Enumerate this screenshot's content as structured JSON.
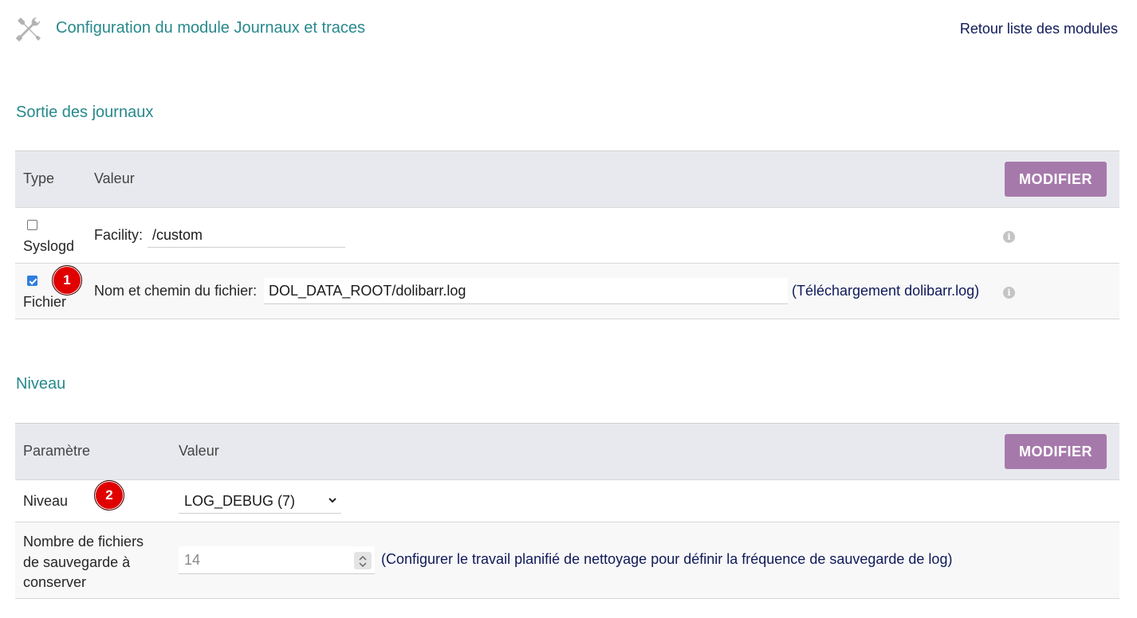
{
  "header": {
    "title": "Configuration du module Journaux et traces",
    "back_link": "Retour liste des modules",
    "icon": "tools-icon"
  },
  "log_output": {
    "section_title": "Sortie des journaux",
    "columns": {
      "type": "Type",
      "value": "Valeur"
    },
    "modify_label": "MODIFIER",
    "rows": [
      {
        "type": "Syslogd",
        "checked": false,
        "field_label": "Facility:",
        "field_value": "/custom"
      },
      {
        "type": "Fichier",
        "checked": true,
        "badge": "1",
        "field_label": "Nom et chemin du fichier:",
        "field_value": "DOL_DATA_ROOT/dolibarr.log",
        "link": "(Téléchargement dolibarr.log)"
      }
    ]
  },
  "level": {
    "section_title": "Niveau",
    "columns": {
      "param": "Paramètre",
      "value": "Valeur"
    },
    "modify_label": "MODIFIER",
    "rows": [
      {
        "label": "Niveau",
        "badge": "2",
        "selected": "LOG_DEBUG (7)"
      },
      {
        "label_lines": [
          "Nombre de fichiers",
          "de sauvegarde à",
          "conserver"
        ],
        "value": "14",
        "link": "(Configurer le travail planifié de nettoyage pour définir la fréquence de sauvegarde de log)"
      }
    ]
  },
  "colors": {
    "accent_title": "#27898c",
    "button": "#a679ab",
    "link": "#0f1a59",
    "badge": "#e00000"
  }
}
